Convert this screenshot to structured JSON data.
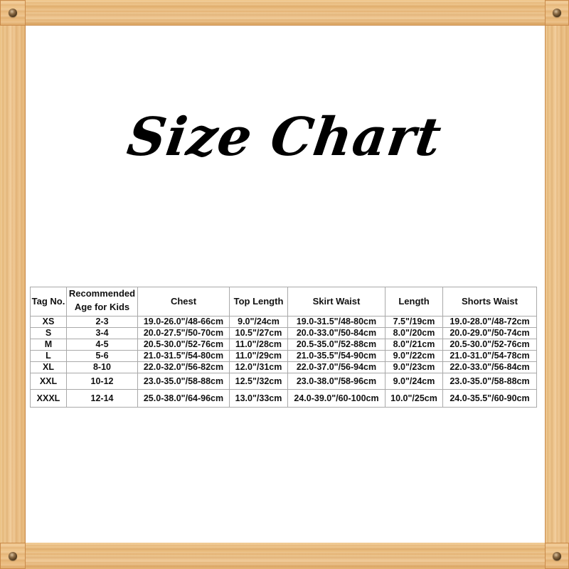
{
  "title": "Size Chart",
  "colors": {
    "frame_wood": "#e8b878",
    "frame_edge": "#c98a4a",
    "background": "#ffffff",
    "text": "#000000",
    "table_border": "#a9a9a9"
  },
  "table": {
    "headers": {
      "tag": "Tag No.",
      "age_line1": "Recommended",
      "age_line2": "Age for Kids",
      "chest": "Chest",
      "top_length": "Top Length",
      "skirt_waist": "Skirt Waist",
      "length": "Length",
      "shorts_waist": "Shorts Waist"
    },
    "rows": [
      {
        "tag": "XS",
        "age": "2-3",
        "chest": "19.0-26.0\"/48-66cm",
        "top_length": "9.0\"/24cm",
        "skirt_waist": "19.0-31.5\"/48-80cm",
        "length": "7.5\"/19cm",
        "shorts_waist": "19.0-28.0\"/48-72cm"
      },
      {
        "tag": "S",
        "age": "3-4",
        "chest": "20.0-27.5\"/50-70cm",
        "top_length": "10.5\"/27cm",
        "skirt_waist": "20.0-33.0\"/50-84cm",
        "length": "8.0\"/20cm",
        "shorts_waist": "20.0-29.0\"/50-74cm"
      },
      {
        "tag": "M",
        "age": "4-5",
        "chest": "20.5-30.0\"/52-76cm",
        "top_length": "11.0\"/28cm",
        "skirt_waist": "20.5-35.0\"/52-88cm",
        "length": "8.0\"/21cm",
        "shorts_waist": "20.5-30.0\"/52-76cm"
      },
      {
        "tag": "L",
        "age": "5-6",
        "chest": "21.0-31.5\"/54-80cm",
        "top_length": "11.0\"/29cm",
        "skirt_waist": "21.0-35.5\"/54-90cm",
        "length": "9.0\"/22cm",
        "shorts_waist": "21.0-31.0\"/54-78cm"
      },
      {
        "tag": "XL",
        "age": "8-10",
        "chest": "22.0-32.0\"/56-82cm",
        "top_length": "12.0\"/31cm",
        "skirt_waist": "22.0-37.0\"/56-94cm",
        "length": "9.0\"/23cm",
        "shorts_waist": "22.0-33.0\"/56-84cm"
      },
      {
        "tag": "XXL",
        "age": "10-12",
        "chest": "23.0-35.0\"/58-88cm",
        "top_length": "12.5\"/32cm",
        "skirt_waist": "23.0-38.0\"/58-96cm",
        "length": "9.0\"/24cm",
        "shorts_waist": "23.0-35.0\"/58-88cm"
      },
      {
        "tag": "XXXL",
        "age": "12-14",
        "chest": "25.0-38.0\"/64-96cm",
        "top_length": "13.0\"/33cm",
        "skirt_waist": "24.0-39.0\"/60-100cm",
        "length": "10.0\"/25cm",
        "shorts_waist": "24.0-35.5\"/60-90cm"
      }
    ]
  }
}
